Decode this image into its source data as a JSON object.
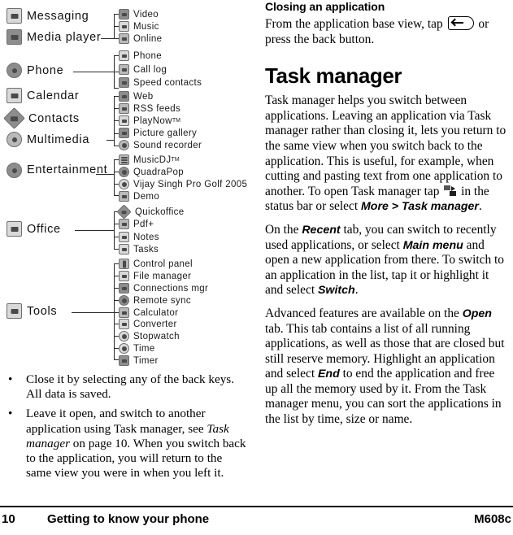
{
  "page": {
    "footer": {
      "page_number": "10",
      "section": "Getting to know your phone",
      "model": "M608c"
    }
  },
  "menu_tree": {
    "groups": [
      {
        "parents": [
          {
            "label": "Messaging",
            "icon": "envelope-icon"
          },
          {
            "label": "Media player",
            "icon": "media-player-icon"
          }
        ],
        "children": [
          {
            "label": "Video",
            "icon": "video-icon"
          },
          {
            "label": "Music",
            "icon": "music-note-icon"
          },
          {
            "label": "Online",
            "icon": "online-icon"
          }
        ]
      },
      {
        "parents": [
          {
            "label": "Phone",
            "icon": "phone-handset-icon"
          }
        ],
        "children": [
          {
            "label": "Phone",
            "icon": "phone-icon"
          },
          {
            "label": "Call log",
            "icon": "call-log-icon"
          },
          {
            "label": "Speed contacts",
            "icon": "speed-contacts-icon"
          }
        ]
      },
      {
        "parents": [
          {
            "label": "Calendar",
            "icon": "calendar-icon"
          },
          {
            "label": "Contacts",
            "icon": "contacts-icon"
          },
          {
            "label": "Multimedia",
            "icon": "multimedia-icon"
          }
        ],
        "children": [
          {
            "label": "Web",
            "icon": "web-icon"
          },
          {
            "label": "RSS feeds",
            "icon": "rss-icon"
          },
          {
            "label": "PlayNow",
            "sup": "TM",
            "icon": "playnow-icon"
          },
          {
            "label": "Picture gallery",
            "icon": "picture-gallery-icon"
          },
          {
            "label": "Sound recorder",
            "icon": "sound-recorder-icon"
          }
        ]
      },
      {
        "parents": [
          {
            "label": "Entertainment",
            "icon": "gamepad-icon"
          }
        ],
        "children": [
          {
            "label": "MusicDJ",
            "sup": "TM",
            "icon": "musicdj-icon"
          },
          {
            "label": "QuadraPop",
            "icon": "quadrapop-icon"
          },
          {
            "label": "Vijay Singh Pro Golf 2005",
            "icon": "golf-icon"
          },
          {
            "label": "Demo",
            "icon": "demo-icon"
          }
        ]
      },
      {
        "parents": [
          {
            "label": "Office",
            "icon": "office-icon"
          }
        ],
        "children": [
          {
            "label": "Quickoffice",
            "icon": "quickoffice-icon"
          },
          {
            "label": "Pdf+",
            "icon": "pdf-icon"
          },
          {
            "label": "Notes",
            "icon": "notes-icon"
          },
          {
            "label": "Tasks",
            "icon": "tasks-icon"
          }
        ]
      },
      {
        "parents": [
          {
            "label": "Tools",
            "icon": "tools-icon"
          }
        ],
        "children": [
          {
            "label": "Control panel",
            "icon": "control-panel-icon"
          },
          {
            "label": "File manager",
            "icon": "file-manager-icon"
          },
          {
            "label": "Connections mgr",
            "icon": "connections-mgr-icon"
          },
          {
            "label": "Remote sync",
            "icon": "remote-sync-icon"
          },
          {
            "label": "Calculator",
            "icon": "calculator-icon"
          },
          {
            "label": "Converter",
            "icon": "converter-icon"
          },
          {
            "label": "Stopwatch",
            "icon": "stopwatch-icon"
          },
          {
            "label": "Time",
            "icon": "clock-icon"
          },
          {
            "label": "Timer",
            "icon": "timer-icon"
          }
        ]
      }
    ]
  },
  "left_bullets": [
    {
      "parts": [
        {
          "t": "Close it by selecting any of the back keys. All data is saved.",
          "style": "normal"
        }
      ]
    },
    {
      "parts": [
        {
          "t": "Leave it open, and switch to another application using Task manager, see ",
          "style": "normal"
        },
        {
          "t": "Task manager",
          "style": "italic"
        },
        {
          "t": " on page 10. When you switch back to the application, you will return to the same view you were in when you left it.",
          "style": "normal"
        }
      ]
    }
  ],
  "right_column": {
    "closing_heading": "Closing an application",
    "closing_para_pre": "From the application base view, tap ",
    "closing_para_post": " or press the back button.",
    "task_manager_heading": "Task manager",
    "para1_pre": "Task manager helps you switch between applications. Leaving an application via Task manager rather than closing it, lets you return to the same view when you switch back to the application. This is useful, for example, when cutting and pasting text from one application to another. To open Task manager tap ",
    "para1_mid": " in the status bar or select ",
    "para1_bold": "More > Task manager",
    "para1_end": ".",
    "para2_a": "On the ",
    "para2_b1": "Recent",
    "para2_c": " tab, you can switch to recently used applications, or select ",
    "para2_b2": "Main menu",
    "para2_d": " and open a new application from there. To switch to an application in the list, tap it or highlight it and select ",
    "para2_b3": "Switch",
    "para2_e": ".",
    "para3_a": "Advanced features are available on the ",
    "para3_b1": "Open",
    "para3_c": " tab. This tab contains a list of all running applications, as well as those that are closed but still reserve memory. Highlight an application and select ",
    "para3_b2": "End",
    "para3_d": " to end the application and free up all the memory used by it. From the Task manager menu, you can sort the applications in the list by time, size or name."
  }
}
